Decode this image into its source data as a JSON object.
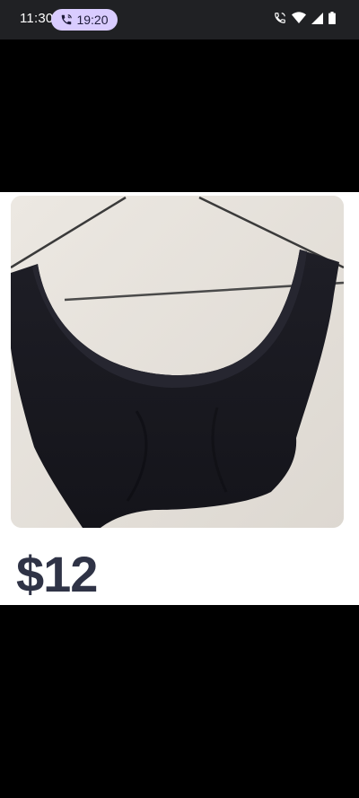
{
  "status_bar": {
    "time": "11:30",
    "call_timer": "19:20",
    "icons": [
      "phone-call-icon",
      "wifi-calling-icon",
      "wifi-icon",
      "signal-icon",
      "battery-icon"
    ]
  },
  "listing": {
    "image_description_icon": "product-photo-black-crop-top",
    "price": "$12"
  },
  "colors": {
    "status_bar_bg": "#202124",
    "call_chip_bg": "#d9ccff",
    "price_text": "#2f3346",
    "background": "#000000"
  }
}
